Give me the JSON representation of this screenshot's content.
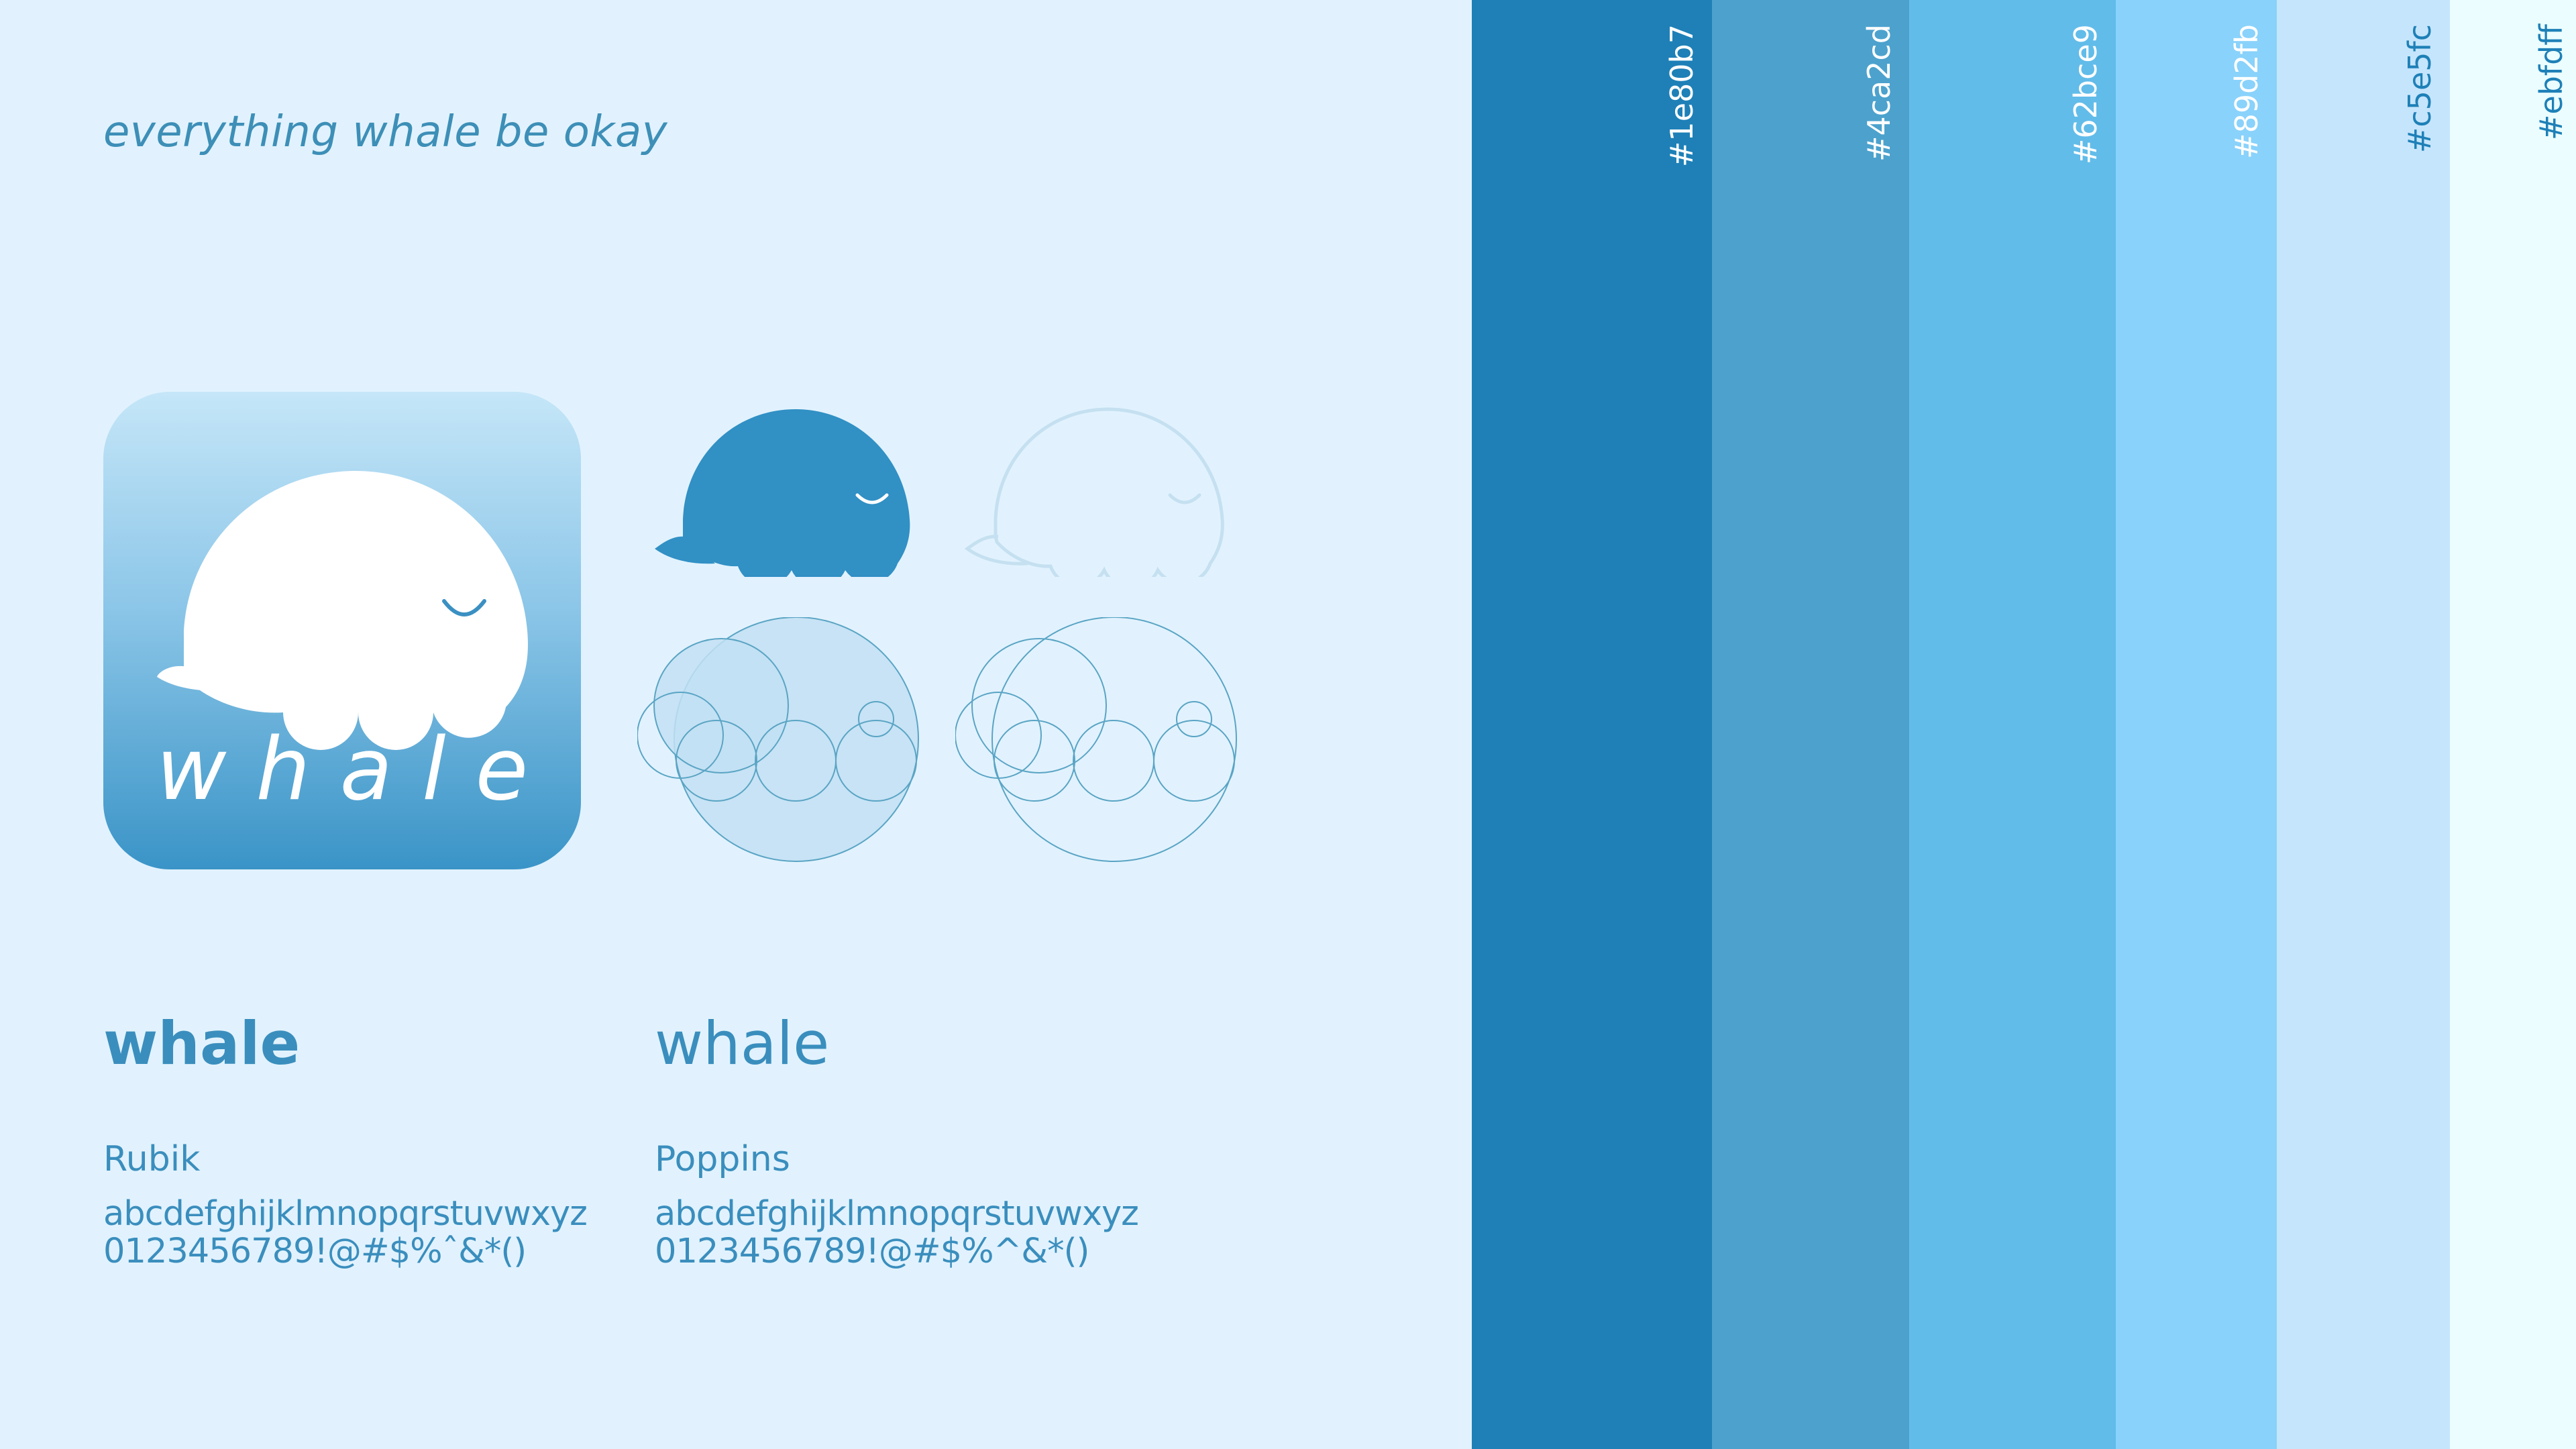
{
  "tagline": "everything whale be okay",
  "logo": {
    "app_icon_word": "whale",
    "icon_names": [
      "whale-app-icon",
      "whale-solid-icon",
      "whale-outline-icon",
      "whale-construction-filled-icon",
      "whale-construction-outline-icon"
    ]
  },
  "typography": {
    "primary": {
      "sample": "whale",
      "font_name": "Rubik",
      "lowercase": "abcdefghijklmnopqrstuvwxyz",
      "symbols": "0123456789!@#$%ˆ&*()"
    },
    "secondary": {
      "sample": "whale",
      "font_name": "Poppins",
      "lowercase": "abcdefghijklmnopqrstuvwxyz",
      "symbols": "0123456789!@#$%^&*()"
    }
  },
  "palette": [
    {
      "hex": "#1e80b7",
      "label": "#1e80b7",
      "label_color": "#ffffff"
    },
    {
      "hex": "#4ca2cd",
      "label": "#4ca2cd",
      "label_color": "#ffffff"
    },
    {
      "hex": "#62bce9",
      "label": "#62bce9",
      "label_color": "#ffffff"
    },
    {
      "hex": "#89d2fb",
      "label": "#89d2fb",
      "label_color": "#ffffff"
    },
    {
      "hex": "#c5e5fc",
      "label": "#c5e5fc",
      "label_color": "#1e80b7"
    },
    {
      "hex": "#ebfdff",
      "label": "#ebfdff",
      "label_color": "#1e80b7"
    }
  ],
  "colors": {
    "background": "#e1f2fe",
    "text_primary": "#3a8ebd",
    "mark_solid": "#3190c4",
    "mark_outline": "#c5e0f0",
    "construction_line": "#5aa4c4",
    "construction_fill": "#c2e0f3"
  }
}
